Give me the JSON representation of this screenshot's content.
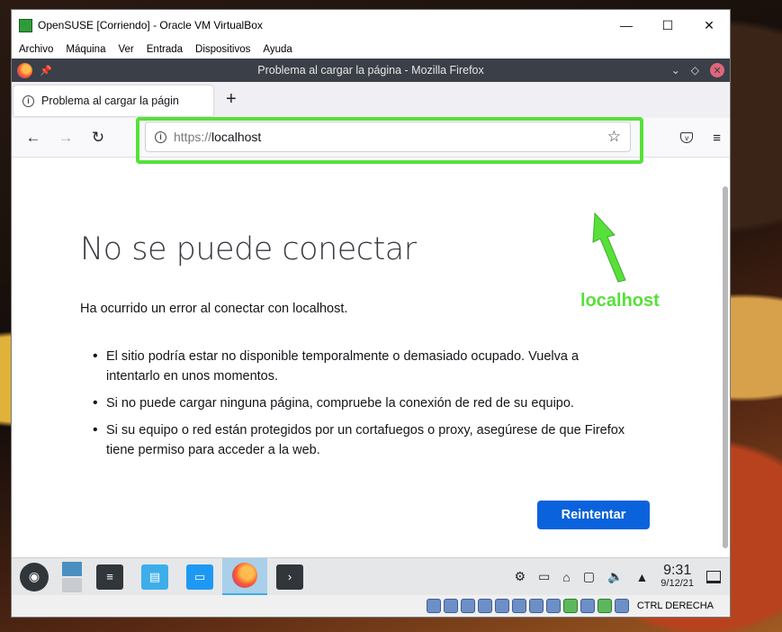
{
  "vbox": {
    "title": "OpenSUSE [Corriendo] - Oracle VM VirtualBox",
    "menu": [
      "Archivo",
      "Máquina",
      "Ver",
      "Entrada",
      "Dispositivos",
      "Ayuda"
    ],
    "controls": {
      "minimize": "—",
      "maximize": "☐",
      "close": "✕"
    },
    "host_key": "CTRL DERECHA"
  },
  "firefox": {
    "window_title": "Problema al cargar la página - Mozilla Firefox",
    "tab_label": "Problema al cargar la págin",
    "url_protocol": "https://",
    "url_host": "localhost"
  },
  "error": {
    "title": "No se puede conectar",
    "description": "Ha ocurrido un error al conectar con localhost.",
    "items": [
      "El sitio podría estar no disponible temporalmente o demasiado ocupado. Vuelva a intentarlo en unos momentos.",
      "Si no puede cargar ninguna página, compruebe la conexión de red de su equipo.",
      "Si su equipo o red están protegidos por un cortafuegos o proxy, asegúrese de que Firefox tiene permiso para acceder a la web."
    ],
    "retry_label": "Reintentar"
  },
  "annotation": {
    "label": "localhost",
    "color": "#57e03a"
  },
  "panel": {
    "time": "9:31",
    "date": "9/12/21"
  },
  "colors": {
    "accent": "#0a62dc",
    "ff_titlebar": "#3b3f47",
    "highlight": "#57e03a"
  }
}
